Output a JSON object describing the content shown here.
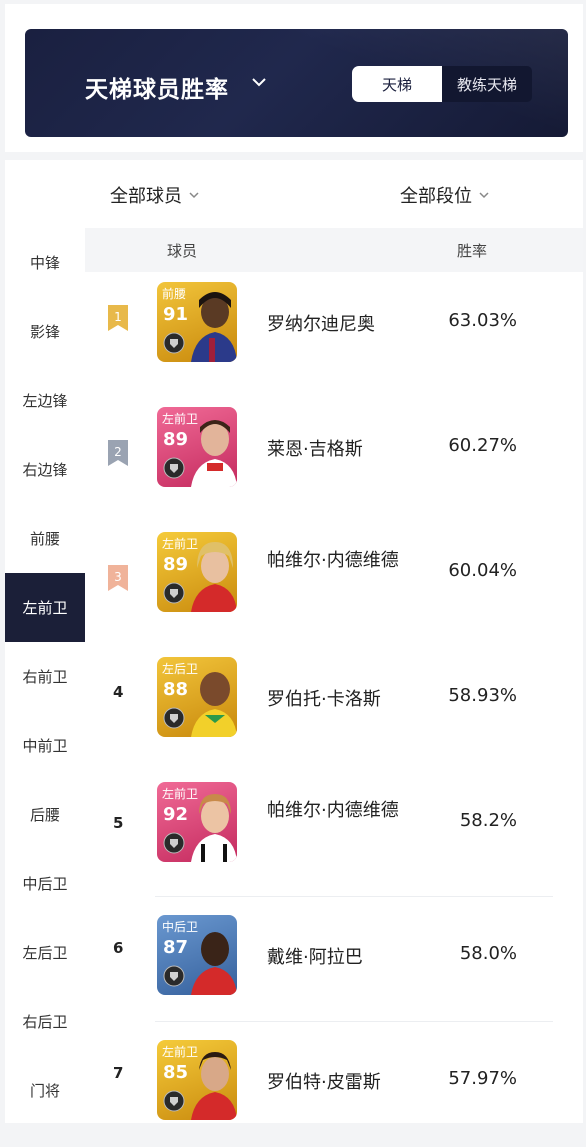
{
  "header": {
    "title": "天梯球员胜率",
    "tabs": [
      "天梯",
      "教练天梯"
    ]
  },
  "filters": {
    "players": "全部球员",
    "tiers": "全部段位"
  },
  "sidebar": {
    "items": [
      "中锋",
      "影锋",
      "左边锋",
      "右边锋",
      "前腰",
      "左前卫",
      "右前卫",
      "中前卫",
      "后腰",
      "中后卫",
      "左后卫",
      "右后卫",
      "门将"
    ],
    "active": "左前卫"
  },
  "table": {
    "col_player": "球员",
    "col_rate": "胜率",
    "rows": [
      {
        "rank": "1",
        "position": "前腰",
        "rating": "91",
        "name": "罗纳尔迪尼奥",
        "rate": "63.03%"
      },
      {
        "rank": "2",
        "position": "左前卫",
        "rating": "89",
        "name": "莱恩·吉格斯",
        "rate": "60.27%"
      },
      {
        "rank": "3",
        "position": "左前卫",
        "rating": "89",
        "name": "帕维尔·内德维德",
        "rate": "60.04%"
      },
      {
        "rank": "4",
        "position": "左后卫",
        "rating": "88",
        "name": "罗伯托·卡洛斯",
        "rate": "58.93%"
      },
      {
        "rank": "5",
        "position": "左前卫",
        "rating": "92",
        "name": "帕维尔·内德维德",
        "rate": "58.2%"
      },
      {
        "rank": "6",
        "position": "中后卫",
        "rating": "87",
        "name": "戴维·阿拉巴",
        "rate": "58.0%"
      },
      {
        "rank": "7",
        "position": "左前卫",
        "rating": "85",
        "name": "罗伯特·皮雷斯",
        "rate": "57.97%"
      }
    ]
  },
  "colors": {
    "banner": "#1a2040",
    "active_tab_bg": "#1b1f38",
    "rank1": "#e8b94a",
    "rank2": "#9aa3b2",
    "rank3": "#f0b39a",
    "card_gold": "#d9a21a",
    "card_pink": "#e0457a",
    "card_blue": "#4a7ab8"
  },
  "icons": {
    "title_chevron": "chevron-down-icon",
    "filter_chevron": "chevron-down-icon",
    "rank_badge": "ribbon-badge-icon",
    "card_emblem": "shield-emblem-icon"
  }
}
